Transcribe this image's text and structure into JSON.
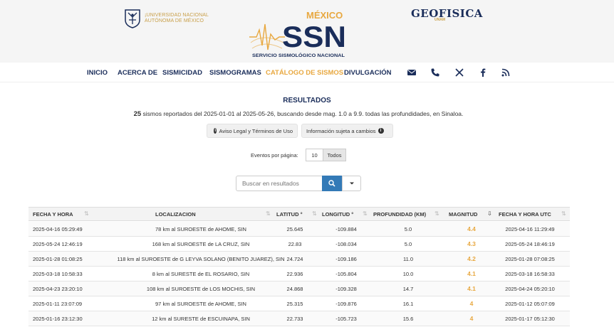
{
  "header": {
    "unam_line1": "¡UNIVERSIDAD NACIONAL",
    "unam_line2": "AUTÓNOMA DE MÉXICO",
    "ssn_country": "MÉXICO",
    "ssn_acronym": "SSN",
    "ssn_fullname": "SERVICIO SISMOLÓGICO NACIONAL",
    "geo_name": "GEOFISICA",
    "geo_sub": "UNAM",
    "brand_navy": "#1a2d5a",
    "brand_gold": "#e8a840"
  },
  "nav": {
    "items": [
      {
        "label": "INICIO"
      },
      {
        "label": "ACERCA DE"
      },
      {
        "label": "SISMICIDAD"
      },
      {
        "label": "SISMOGRAMAS"
      },
      {
        "label": "CATÁLOGO DE SISMOS",
        "active": true
      },
      {
        "label": "DIVULGACIÓN"
      }
    ],
    "icons": [
      "email-icon",
      "phone-icon",
      "x-twitter-icon",
      "facebook-icon",
      "rss-icon"
    ]
  },
  "results": {
    "title": "RESULTADOS",
    "count": "25",
    "summary_rest": " sismos reportados del 2025-01-01 al 2025-05-26, buscando desde mag. 1.0 a 9.9. todas las profundidades, en Sinaloa.",
    "legal_button": "Aviso Legal y Términos de Uso",
    "info_button": "Información sujeta a cambios",
    "per_page_label": "Eventos por página:",
    "per_page_value": "10",
    "per_page_all": "Todos",
    "search_placeholder": "Buscar en resultados"
  },
  "table": {
    "headers": [
      "FECHA Y HORA",
      "LOCALIZACION",
      "LATITUD °",
      "LONGITUD °",
      "PROFUNDIDAD (KM)",
      "MAGNITUD",
      "FECHA Y HORA UTC"
    ],
    "rows": [
      [
        "2025-04-16  05:29:49",
        "78 km al SUROESTE de AHOME, SIN",
        "25.645",
        "-109.884",
        "5.0",
        "4.4",
        "2025-04-16  11:29:49"
      ],
      [
        "2025-05-24  12:46:19",
        "168 km al SUROESTE de LA CRUZ, SIN",
        "22.83",
        "-108.034",
        "5.0",
        "4.3",
        "2025-05-24  18:46:19"
      ],
      [
        "2025-01-28  01:08:25",
        "118 km al SUROESTE de G LEYVA SOLANO (BENITO JUAREZ), SIN",
        "24.724",
        "-109.186",
        "11.0",
        "4.2",
        "2025-01-28  07:08:25"
      ],
      [
        "2025-03-18  10:58:33",
        "8 km al SURESTE de EL ROSARIO, SIN",
        "22.936",
        "-105.804",
        "10.0",
        "4.1",
        "2025-03-18  16:58:33"
      ],
      [
        "2025-04-23  23:20:10",
        "108 km al SUROESTE de LOS MOCHIS, SIN",
        "24.868",
        "-109.328",
        "14.7",
        "4.1",
        "2025-04-24  05:20:10"
      ],
      [
        "2025-01-11  23:07:09",
        "97 km al SUROESTE de AHOME, SIN",
        "25.315",
        "-109.876",
        "16.1",
        "4",
        "2025-01-12  05:07:09"
      ],
      [
        "2025-01-16  23:12:30",
        "12 km al SURESTE de ESCUINAPA, SIN",
        "22.733",
        "-105.723",
        "15.6",
        "4",
        "2025-01-17  05:12:30"
      ]
    ]
  }
}
